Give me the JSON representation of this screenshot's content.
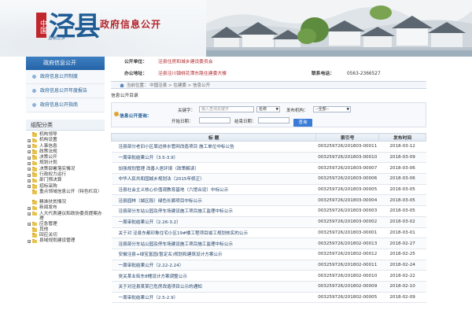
{
  "header": {
    "seal_text": "中国",
    "county_name": "泾县",
    "slogan": "宣纸之乡",
    "portal_title": "政府信息公开"
  },
  "sidebar": {
    "panel_title": "政府信息公开",
    "links": [
      {
        "label": "政府信息公开制度"
      },
      {
        "label": "政府信息公开年度报告"
      },
      {
        "label": "政府信息公开指南"
      }
    ],
    "category_title": "组配分类",
    "tree": [
      {
        "label": "机构领导",
        "expandable": false
      },
      {
        "label": "机构设置",
        "expandable": true
      },
      {
        "label": "人事信息",
        "expandable": true
      },
      {
        "label": "政策法规",
        "expandable": true
      },
      {
        "label": "决策公开",
        "expandable": true
      },
      {
        "label": "规划计划",
        "expandable": true
      },
      {
        "label": "决策部署落实情况",
        "expandable": true
      },
      {
        "label": "行政权力运行",
        "expandable": true
      },
      {
        "label": "部门预决算",
        "expandable": true
      },
      {
        "label": "招标采购",
        "expandable": true
      },
      {
        "label": "重点领域信息公开（特色栏目）",
        "expandable": false,
        "two_line": true
      },
      {
        "label": "精准扶贫情况",
        "expandable": false
      },
      {
        "label": "新闻发布",
        "expandable": true
      },
      {
        "label": "人大代表建议和政协委员提案办理",
        "expandable": true,
        "two_line": true
      },
      {
        "label": "应急管理",
        "expandable": true
      },
      {
        "label": "其他",
        "expandable": false
      },
      {
        "label": "回应关切",
        "expandable": false
      },
      {
        "label": "县域规划建设管理",
        "expandable": true
      }
    ]
  },
  "unit_info": {
    "unit_label": "公开单位：",
    "unit_value": "泾县住房和城乡建设委员会",
    "address_label": "办公地址：",
    "address_value": "泾县泾川镇桃花潭东路住建委大楼",
    "phone_label": "联系电话：",
    "phone_value": "0563-2366527"
  },
  "breadcrumb": {
    "text": "当前位置：  中国泾县 > 住建委 > 信息公开"
  },
  "catalog_label": "信息公开目录",
  "query": {
    "label": "信息公开查询：",
    "keyword_label": "关键字：",
    "keyword_placeholder": "输入查询关键字",
    "scope_value": "名称",
    "org_label": "发布机构：",
    "org_value": "--全部--",
    "start_label": "开始日期：",
    "end_label": "结束日期：",
    "button_label": "查询"
  },
  "table": {
    "headers": [
      "标  题",
      "索引号",
      "发布时间"
    ],
    "rows": [
      [
        "泾县部分老旧小区周边排水管网改造项目 施工单位中标公告",
        "003259726/201803-00011",
        "2018-03-12"
      ],
      [
        "一周审批结果公开（3.5-3.9）",
        "003259726/201803-00010",
        "2018-03-09"
      ],
      [
        "加强规划管理 改善人居环境（政策解读）",
        "003259726/201803-00007",
        "2018-03-06"
      ],
      [
        "中华人民共和国城乡规划法（2015年修正）",
        "003259726/201803-00006",
        "2018-03-06"
      ],
      [
        "泾县社会主义核心价值观教育基地（六馆合设）中标公示",
        "003259726/201803-00005",
        "2018-03-05"
      ],
      [
        "泾县园林（城区段）绿色长廊项目中标公示",
        "003259726/201803-00004",
        "2018-03-05"
      ],
      [
        "泾县部分车站公园及停车场建设施工项目施工监理中标公示",
        "003259726/201803-00003",
        "2018-03-05"
      ],
      [
        "一周审批结果公开（2.26-3.2）",
        "003259726/201803-00002",
        "2018-03-02"
      ],
      [
        "关于对 泾县东都印象住宅小区19#楼工程项目竣工规划核实的公示",
        "003259726/201803-00001",
        "2018-03-01"
      ],
      [
        "泾县部分车站公园及停车场建设施工项目施工监理中标公示",
        "003259726/201802-00013",
        "2018-02-27"
      ],
      [
        "安徽泾县+绿宝富园(暂定名)规划和建筑设计方案公示",
        "003259726/201802-00012",
        "2018-02-25"
      ],
      [
        "一周审批结果公开（2.22-2.24）",
        "003259726/201802-00011",
        "2018-02-24"
      ],
      [
        "党关某业街东8幢设计方案调整公示",
        "003259726/201802-00010",
        "2018-02-22"
      ],
      [
        "关于对泾县某某已危房改造项目公示的通知",
        "003259726/201802-00009",
        "2018-02-10"
      ],
      [
        "一周审批结果公开（2.5-2.9）",
        "003259726/201802-00005",
        "2018-02-09"
      ]
    ]
  }
}
